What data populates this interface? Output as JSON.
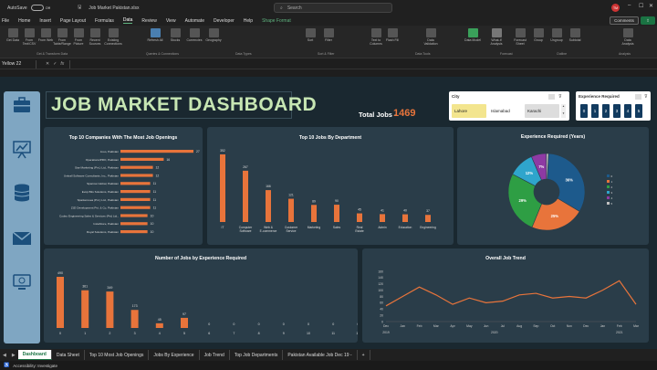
{
  "titlebar": {
    "autosave": "AutoSave",
    "toggle": "Off",
    "filename": "Job Market Pakistan.xlsx",
    "search_placeholder": "Search",
    "avatar": "TM"
  },
  "menu": [
    "File",
    "Home",
    "Insert",
    "Page Layout",
    "Formulas",
    "Data",
    "Review",
    "View",
    "Automate",
    "Developer",
    "Help",
    "Shape Format"
  ],
  "header_buttons": {
    "comments": "Comments",
    "share": "Share"
  },
  "ribbon": {
    "buttons": [
      "Get Data",
      "From Text/CSV",
      "From Web",
      "From Table/Range",
      "From Picture",
      "Recent Sources",
      "Existing Connections",
      "Refresh All",
      "Stocks",
      "Currencies",
      "Geography",
      "Sort",
      "Filter",
      "Text to Columns",
      "Flash Fill",
      "Data Validation",
      "Data Model",
      "What-If Analysis",
      "Forecast Sheet",
      "Group",
      "Ungroup",
      "Subtotal",
      "Data Analysis"
    ],
    "groups": [
      "Get & Transform Data",
      "Queries & Connections",
      "Data Types",
      "Sort & Filter",
      "Data Tools",
      "Forecast",
      "Outline",
      "Analysis"
    ]
  },
  "formula": {
    "namebox": "Yellow 22",
    "fx": "fx"
  },
  "dashboard": {
    "title": "JOB MARKET DASHBOARD",
    "total_label": "Total Jobs -",
    "total_value": "1469",
    "city_slicer": {
      "title": "City",
      "options": [
        "Lahore",
        "Islamabad",
        "Karachi"
      ],
      "selected": "Lahore"
    },
    "exp_slicer": {
      "title": "Experience Required",
      "options": [
        "0",
        "1",
        "2",
        "3",
        "4",
        "5"
      ]
    }
  },
  "chart_data": [
    {
      "type": "bar",
      "orientation": "horizontal",
      "title": "Top 10 Companies With The Most Job Openings",
      "categories": [
        "Jooo, Pakistan",
        "Operations/PRO, Pakistan",
        "Star Marketing (Pvt.) Ltd., Pakistan",
        "Unitrall Software Consultants, Inc., Pakistan",
        "Sparrow Global, Pakistan",
        "Evop Bits Solutions, Pakistan",
        "Sparkerusea (Pvt.) Ltd., Pakistan",
        "ZIZI Development Pvt. & Co, Pakistan",
        "Codeo Engineering Sales & Services (Pvt) Ltd.,",
        "InstaStore, Pakistan",
        "Royal Solutions, Pakistan"
      ],
      "values": [
        27,
        16,
        12,
        12,
        11,
        11,
        11,
        11,
        10,
        10,
        10
      ]
    },
    {
      "type": "bar",
      "title": "Top 10 Jobs By Department",
      "categories": [
        "IT",
        "Computer Software",
        "Web & E-commerce",
        "Customer Service",
        "Marketing",
        "Sales",
        "Real Estate",
        "Admin",
        "Education",
        "Engineering"
      ],
      "values": [
        352,
        267,
        166,
        121,
        89,
        90,
        45,
        41,
        40,
        37
      ]
    },
    {
      "type": "pie",
      "title": "Experience Required (Years)",
      "categories": [
        "0",
        "1",
        "2",
        "3",
        "4",
        "5"
      ],
      "values": [
        36,
        25,
        29,
        12,
        7,
        1
      ],
      "labels": [
        "36%",
        "25%",
        "29%",
        "12%",
        "7%",
        ""
      ],
      "colors": [
        "#1d5a8c",
        "#e8743b",
        "#2e9e44",
        "#2fa5cc",
        "#8e3aa3",
        "#c0c0c0"
      ]
    },
    {
      "type": "bar",
      "title": "Number of Jobs by Experience Required",
      "categories": [
        "0",
        "1",
        "2",
        "3",
        "4",
        "5",
        "6",
        "7",
        "8",
        "9",
        "10",
        "11",
        "15"
      ],
      "values": [
        490,
        361,
        349,
        173,
        45,
        97,
        0,
        0,
        0,
        0,
        0,
        0,
        0
      ]
    },
    {
      "type": "line",
      "title": "Overall Job Trend",
      "x": [
        "Dec",
        "Jan",
        "Feb",
        "Mar",
        "Apr",
        "May",
        "Jun",
        "Jul",
        "Aug",
        "Sep",
        "Oct",
        "Nov",
        "Dec",
        "Jan",
        "Feb",
        "Mar"
      ],
      "years": [
        "2019",
        "2020",
        "2021"
      ],
      "y": [
        50,
        80,
        110,
        85,
        55,
        75,
        60,
        65,
        85,
        90,
        75,
        80,
        75,
        100,
        130,
        55
      ],
      "ylim": [
        0,
        160
      ],
      "yticks": [
        0,
        20,
        40,
        60,
        80,
        100,
        120,
        140,
        160
      ]
    }
  ],
  "sheet_tabs": [
    "Dashboard",
    "Data Sheet",
    "Top 10 Most Job Openings",
    "Jobs By Experience",
    "Job Trend",
    "Top Job Departments",
    "Pakistan Available Job Dec 19 -"
  ],
  "status": {
    "accessibility": "Accessibility: Investigate"
  }
}
